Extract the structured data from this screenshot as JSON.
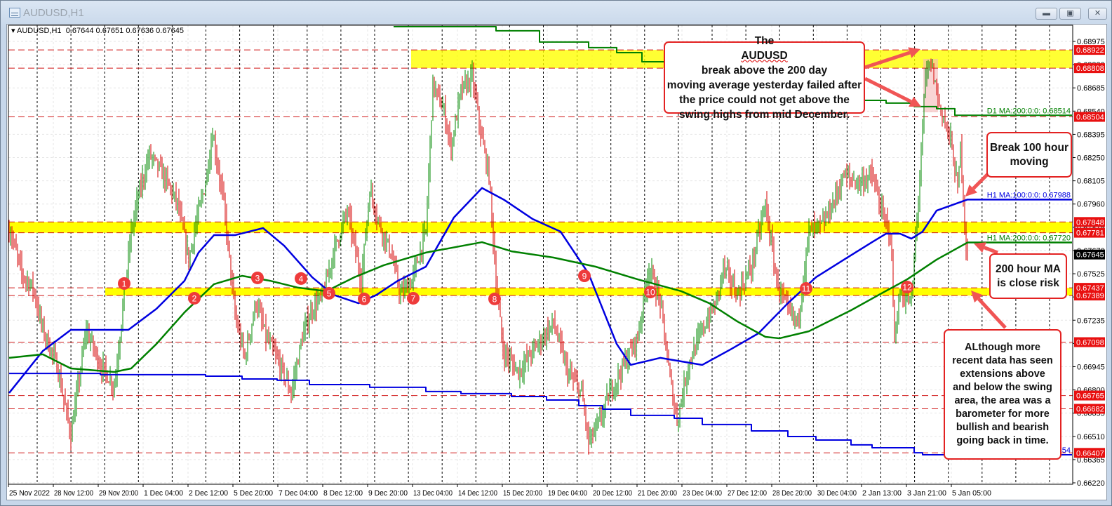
{
  "window": {
    "title": "AUDUSD,H1",
    "buttons": [
      "minimize",
      "maximize",
      "close"
    ]
  },
  "header": {
    "symbol": "AUDUSD,H1",
    "open": "0.67644",
    "high": "0.67651",
    "low": "0.67636",
    "close": "0.67645"
  },
  "colors": {
    "bull": "#008a00",
    "bear": "#d40000",
    "ma_fast": "#0000e0",
    "ma_slow": "#008000",
    "level": "#d01818",
    "band": "#ffff00",
    "arrow": "#f05555"
  },
  "annotations": {
    "top": {
      "pre": "The ",
      "flag": "AUDUSD",
      "post": " break above the 200 day",
      "lines": [
        "moving average yesterday failed after",
        "the price could not get above the",
        "swing highs from mid December."
      ]
    },
    "break": [
      "Break 100 hour",
      "moving"
    ],
    "ma200": [
      "200 hour MA",
      "is close risk"
    ],
    "swing": [
      "ALthough more",
      "recent data has seen",
      "extensions above",
      "and below the swing",
      "area, the area was a",
      "barometer for more",
      "bullish and bearish",
      "going back in time."
    ]
  },
  "chart_data": {
    "type": "candlestick",
    "title": "AUDUSD,H1",
    "ylim": [
      0.6622,
      0.68975
    ],
    "y_ticks": [
      "0.68975",
      "0.68830",
      "0.68685",
      "0.68540",
      "0.68395",
      "0.68250",
      "0.68105",
      "0.67960",
      "0.67815",
      "0.67670",
      "0.67525",
      "0.67380",
      "0.67235",
      "0.67090",
      "0.66945",
      "0.66800",
      "0.66655",
      "0.66510",
      "0.66365",
      "0.66220"
    ],
    "x_labels": [
      "25 Nov 2022",
      "28 Nov 12:00",
      "29 Nov 20:00",
      "1 Dec 04:00",
      "2 Dec 12:00",
      "5 Dec 20:00",
      "7 Dec 04:00",
      "8 Dec 12:00",
      "9 Dec 20:00",
      "13 Dec 04:00",
      "14 Dec 12:00",
      "15 Dec 20:00",
      "19 Dec 04:00",
      "20 Dec 12:00",
      "21 Dec 20:00",
      "23 Dec 04:00",
      "27 Dec 12:00",
      "28 Dec 20:00",
      "30 Dec 04:00",
      "2 Jan 13:00",
      "3 Jan 21:00",
      "5 Jan 05:00"
    ],
    "bars_per_label": 32,
    "bar_count": 684,
    "current_price": "0.67645",
    "price_path": [
      [
        1,
        0.67788
      ],
      [
        9,
        0.67525
      ],
      [
        17,
        0.67438
      ],
      [
        24,
        0.67175
      ],
      [
        34,
        0.66956
      ],
      [
        44,
        0.66518
      ],
      [
        55,
        0.67175
      ],
      [
        65,
        0.66956
      ],
      [
        75,
        0.66824
      ],
      [
        82,
        0.67394
      ],
      [
        87,
        0.67788
      ],
      [
        92,
        0.68007
      ],
      [
        100,
        0.6827
      ],
      [
        110,
        0.68138
      ],
      [
        120,
        0.67963
      ],
      [
        128,
        0.67613
      ],
      [
        133,
        0.67832
      ],
      [
        140,
        0.68095
      ],
      [
        145,
        0.68401
      ],
      [
        153,
        0.67963
      ],
      [
        161,
        0.67262
      ],
      [
        168,
        0.67
      ],
      [
        176,
        0.6735
      ],
      [
        183,
        0.67131
      ],
      [
        193,
        0.66956
      ],
      [
        201,
        0.66781
      ],
      [
        209,
        0.67131
      ],
      [
        216,
        0.67306
      ],
      [
        224,
        0.67394
      ],
      [
        231,
        0.67657
      ],
      [
        241,
        0.67919
      ],
      [
        251,
        0.67481
      ],
      [
        257,
        0.68051
      ],
      [
        264,
        0.67832
      ],
      [
        272,
        0.67657
      ],
      [
        279,
        0.67394
      ],
      [
        287,
        0.67481
      ],
      [
        297,
        0.67788
      ],
      [
        302,
        0.68708
      ],
      [
        310,
        0.68533
      ],
      [
        315,
        0.68314
      ],
      [
        322,
        0.68664
      ],
      [
        330,
        0.68752
      ],
      [
        337,
        0.68357
      ],
      [
        342,
        0.68138
      ],
      [
        347,
        0.67481
      ],
      [
        352,
        0.67043
      ],
      [
        363,
        0.66912
      ],
      [
        373,
        0.67043
      ],
      [
        388,
        0.67219
      ],
      [
        398,
        0.66912
      ],
      [
        408,
        0.66781
      ],
      [
        413,
        0.66474
      ],
      [
        421,
        0.66605
      ],
      [
        428,
        0.66781
      ],
      [
        438,
        0.66956
      ],
      [
        448,
        0.67131
      ],
      [
        456,
        0.67569
      ],
      [
        464,
        0.6735
      ],
      [
        471,
        0.66868
      ],
      [
        476,
        0.66605
      ],
      [
        484,
        0.66956
      ],
      [
        494,
        0.67175
      ],
      [
        504,
        0.6735
      ],
      [
        509,
        0.67569
      ],
      [
        519,
        0.67394
      ],
      [
        529,
        0.67569
      ],
      [
        539,
        0.67963
      ],
      [
        547,
        0.67481
      ],
      [
        554,
        0.67306
      ],
      [
        562,
        0.67219
      ],
      [
        570,
        0.67788
      ],
      [
        580,
        0.67832
      ],
      [
        587,
        0.67963
      ],
      [
        595,
        0.68138
      ],
      [
        605,
        0.68095
      ],
      [
        615,
        0.68138
      ],
      [
        623,
        0.67876
      ],
      [
        628,
        0.67788
      ],
      [
        631,
        0.67131
      ],
      [
        635,
        0.67394
      ],
      [
        643,
        0.6735
      ],
      [
        650,
        0.6827
      ],
      [
        653,
        0.68752
      ],
      [
        657,
        0.68839
      ],
      [
        663,
        0.68576
      ],
      [
        671,
        0.68357
      ],
      [
        676,
        0.68051
      ],
      [
        678,
        0.68314
      ],
      [
        682,
        0.677
      ],
      [
        683,
        0.67645
      ]
    ],
    "series": [
      {
        "name": "H1 MA:100:0:0",
        "label": "H1 MA:100:0:0: 0.67988",
        "color": "#0000e0",
        "width": 2.5,
        "step": false,
        "points": [
          [
            0,
            0.66781
          ],
          [
            24,
            0.67043
          ],
          [
            44,
            0.67175
          ],
          [
            65,
            0.67175
          ],
          [
            85,
            0.67175
          ],
          [
            105,
            0.67306
          ],
          [
            125,
            0.67481
          ],
          [
            135,
            0.67657
          ],
          [
            146,
            0.67766
          ],
          [
            161,
            0.67766
          ],
          [
            181,
            0.6781
          ],
          [
            196,
            0.677
          ],
          [
            216,
            0.67503
          ],
          [
            231,
            0.67394
          ],
          [
            249,
            0.67341
          ],
          [
            262,
            0.67394
          ],
          [
            277,
            0.67481
          ],
          [
            297,
            0.67569
          ],
          [
            317,
            0.67876
          ],
          [
            337,
            0.6806
          ],
          [
            353,
            0.67985
          ],
          [
            373,
            0.67867
          ],
          [
            393,
            0.67788
          ],
          [
            413,
            0.67525
          ],
          [
            433,
            0.67087
          ],
          [
            443,
            0.66956
          ],
          [
            464,
            0.67
          ],
          [
            494,
            0.66956
          ],
          [
            514,
            0.67052
          ],
          [
            534,
            0.67153
          ],
          [
            555,
            0.67341
          ],
          [
            575,
            0.67503
          ],
          [
            595,
            0.67613
          ],
          [
            615,
            0.67722
          ],
          [
            625,
            0.67775
          ],
          [
            635,
            0.67775
          ],
          [
            643,
            0.67744
          ],
          [
            651,
            0.67788
          ],
          [
            661,
            0.67919
          ],
          [
            683,
            0.67988
          ]
        ]
      },
      {
        "name": "H1 MA:200:0:0",
        "label": "H1 MA:200:0:0: 0.67720",
        "color": "#008000",
        "width": 2.5,
        "step": false,
        "points": [
          [
            0,
            0.67
          ],
          [
            24,
            0.67022
          ],
          [
            44,
            0.66934
          ],
          [
            75,
            0.66912
          ],
          [
            87,
            0.66934
          ],
          [
            105,
            0.67087
          ],
          [
            125,
            0.67284
          ],
          [
            146,
            0.6746
          ],
          [
            166,
            0.67512
          ],
          [
            186,
            0.67481
          ],
          [
            206,
            0.67438
          ],
          [
            226,
            0.67416
          ],
          [
            246,
            0.67503
          ],
          [
            267,
            0.67578
          ],
          [
            297,
            0.67657
          ],
          [
            337,
            0.67722
          ],
          [
            358,
            0.67665
          ],
          [
            388,
            0.67626
          ],
          [
            418,
            0.67569
          ],
          [
            448,
            0.6749
          ],
          [
            479,
            0.67416
          ],
          [
            499,
            0.67341
          ],
          [
            519,
            0.67227
          ],
          [
            539,
            0.67131
          ],
          [
            549,
            0.67122
          ],
          [
            570,
            0.67166
          ],
          [
            600,
            0.67297
          ],
          [
            620,
            0.67394
          ],
          [
            640,
            0.6749
          ],
          [
            661,
            0.67613
          ],
          [
            683,
            0.6772
          ]
        ]
      },
      {
        "name": "D1 MA:200:0:0",
        "label": "D1 MA:200:0:0: 0.68514",
        "color": "#008000",
        "width": 2,
        "step": true,
        "points": [
          [
            274,
            0.69067
          ],
          [
            347,
            0.69041
          ],
          [
            378,
            0.68971
          ],
          [
            413,
            0.68936
          ],
          [
            433,
            0.68905
          ],
          [
            451,
            0.68848
          ],
          [
            537,
            0.68642
          ],
          [
            565,
            0.6862
          ],
          [
            600,
            0.68607
          ],
          [
            625,
            0.6859
          ],
          [
            645,
            0.68568
          ],
          [
            661,
            0.68555
          ],
          [
            674,
            0.68514
          ]
        ]
      },
      {
        "name": "D1 MA:100:0:0",
        "label": "354",
        "color": "#0000e0",
        "width": 2,
        "step": true,
        "points": [
          [
            0,
            0.66903
          ],
          [
            65,
            0.66895
          ],
          [
            140,
            0.66886
          ],
          [
            166,
            0.66868
          ],
          [
            191,
            0.6686
          ],
          [
            214,
            0.66833
          ],
          [
            257,
            0.66816
          ],
          [
            297,
            0.6679
          ],
          [
            322,
            0.66777
          ],
          [
            358,
            0.66759
          ],
          [
            383,
            0.66737
          ],
          [
            406,
            0.66702
          ],
          [
            423,
            0.6668
          ],
          [
            443,
            0.66641
          ],
          [
            474,
            0.66623
          ],
          [
            494,
            0.66584
          ],
          [
            529,
            0.66544
          ],
          [
            555,
            0.66509
          ],
          [
            575,
            0.66487
          ],
          [
            600,
            0.66457
          ],
          [
            615,
            0.66439
          ],
          [
            645,
            0.66408
          ],
          [
            651,
            0.66395
          ]
        ]
      }
    ],
    "levels": [
      "0.68922",
      "0.68808",
      "0.68504",
      "0.67848",
      "0.67781",
      "0.67437",
      "0.67389",
      "0.67098",
      "0.66765",
      "0.66682",
      "0.66407"
    ],
    "bands": [
      {
        "from": 0.68808,
        "to": 0.68922,
        "start_bar": 287
      },
      {
        "from": 0.67781,
        "to": 0.67848,
        "start_bar": 0
      },
      {
        "from": 0.67389,
        "to": 0.67437,
        "start_bar": 69
      }
    ],
    "markers": [
      {
        "label": "1",
        "bar": 82,
        "price": 0.67464
      },
      {
        "label": "2",
        "bar": 132,
        "price": 0.67372
      },
      {
        "label": "3",
        "bar": 177,
        "price": 0.67499
      },
      {
        "label": "4",
        "bar": 208,
        "price": 0.67495
      },
      {
        "label": "5",
        "bar": 228,
        "price": 0.67403
      },
      {
        "label": "6",
        "bar": 253,
        "price": 0.67368
      },
      {
        "label": "7",
        "bar": 288,
        "price": 0.67372
      },
      {
        "label": "8",
        "bar": 346,
        "price": 0.67368
      },
      {
        "label": "9",
        "bar": 410,
        "price": 0.67512
      },
      {
        "label": "10",
        "bar": 457,
        "price": 0.67411
      },
      {
        "label": "11",
        "bar": 568,
        "price": 0.67433
      },
      {
        "label": "12",
        "bar": 640,
        "price": 0.67442
      }
    ]
  }
}
